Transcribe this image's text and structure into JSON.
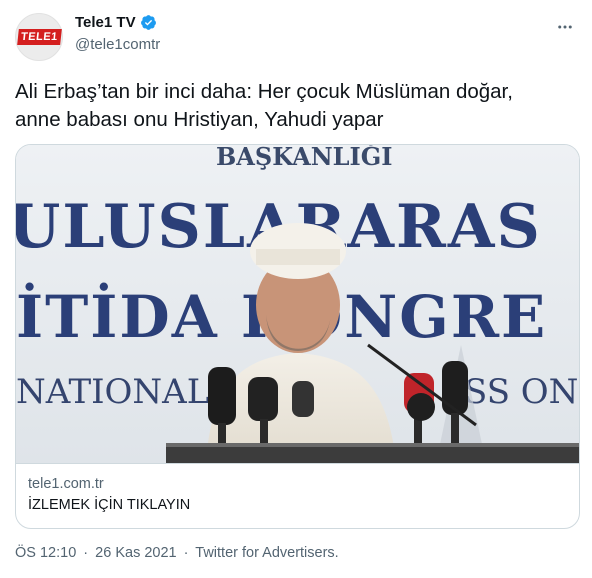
{
  "author": {
    "display_name": "Tele1 TV",
    "handle": "@tele1comtr",
    "avatar_logo_text": "TELE1",
    "verified": true,
    "verified_color": "#1d9bf0"
  },
  "tweet": {
    "lines": [
      "Ali Erbaş’tan bir inci daha: Her çocuk Müslüman doğar,",
      "anne babası onu Hristiyan, Yahudi yapar"
    ]
  },
  "card": {
    "banner_lines": [
      "BAŞKANLIĞI",
      "ULUSLARARAS",
      "İTİDA KONGRE",
      "NATIONAL",
      "SS ON"
    ],
    "domain": "tele1.com.tr",
    "title": "İZLEMEK İÇİN TIKLAYIN"
  },
  "meta": {
    "time": "ÖS 12:10",
    "separator_1": "·",
    "date": "26 Kas 2021",
    "separator_2": "·",
    "source": "Twitter for Advertisers."
  },
  "icons": {
    "more": "more-icon",
    "verified": "verified-badge-icon"
  }
}
